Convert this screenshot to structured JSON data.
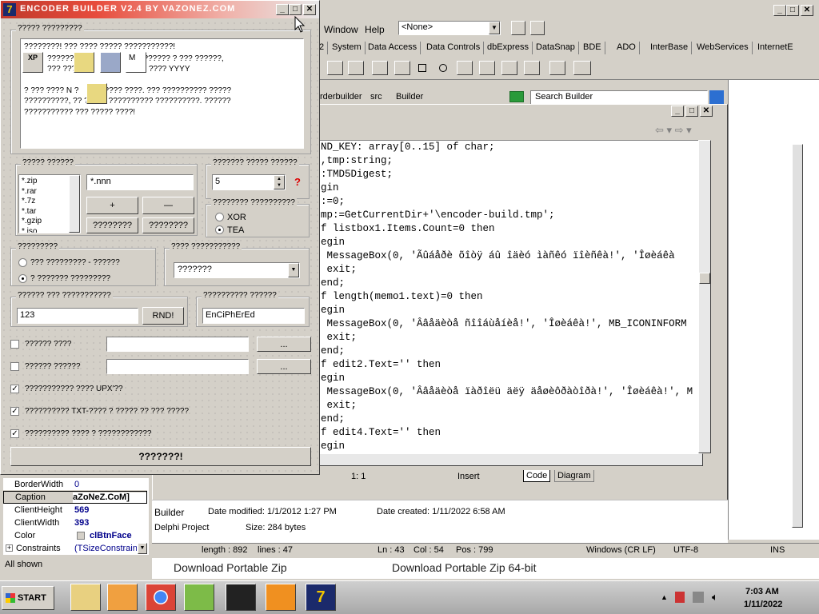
{
  "ide": {
    "menu": [
      "Window",
      "Help"
    ],
    "config_select": "<None>",
    "palette_tabs": [
      "2",
      "System",
      "Data Access",
      "Data Controls",
      "dbExpress",
      "DataSnap",
      "BDE",
      "ADO",
      "InterBase",
      "WebServices",
      "InternetE"
    ],
    "breadcrumb": [
      "rderbuilder",
      "src",
      "Builder"
    ],
    "search_placeholder": "Search Builder"
  },
  "editor": {
    "code_lines": [
      {
        "t": "ND_KEY: array[0..15] of char;"
      },
      {
        "t": ",tmp:string;"
      },
      {
        "t": ":TMD5Digest;"
      },
      {
        "t": "gin"
      },
      {
        "t": ":=0;"
      },
      {
        "t": "mp:=GetCurrentDir+'\\encoder-build.tmp';"
      },
      {
        "t": "f listbox1.Items.Count=0 then"
      },
      {
        "t": "egin"
      },
      {
        "t": " MessageBox(0, 'Ãûáåðè õîòÿ áû îäèó ìàñêó ïîèñêà!', 'Îøèáêà"
      },
      {
        "t": " exit;"
      },
      {
        "t": "end;"
      },
      {
        "t": "f length(memo1.text)=0 then"
      },
      {
        "t": "egin"
      },
      {
        "t": " MessageBox(0, 'Ââåäèòå ñîîáùåíèå!', 'Îøèáêà!', MB_ICONINFORM"
      },
      {
        "t": " exit;"
      },
      {
        "t": "end;"
      },
      {
        "t": "f edit2.Text='' then"
      },
      {
        "t": "egin"
      },
      {
        "t": " MessageBox(0, 'Ââåäèòå ïàðîëü äëÿ äåøèôðàòîðà!', 'Îøèáêà!', M"
      },
      {
        "t": " exit;"
      },
      {
        "t": "end;"
      },
      {
        "t": "f edit4.Text='' then"
      },
      {
        "t": "egin"
      }
    ],
    "position": "1:   1",
    "mode": "Insert",
    "tabs": [
      "Code",
      "Diagram"
    ]
  },
  "object_inspector": {
    "rows": [
      {
        "name": "BorderWidth",
        "value": "0"
      },
      {
        "name": "Caption",
        "value": "aZoNeZ.CoM]"
      },
      {
        "name": "ClientHeight",
        "value": "569"
      },
      {
        "name": "ClientWidth",
        "value": "393"
      },
      {
        "name": "Color",
        "value": "clBtnFace"
      },
      {
        "name": "Constraints",
        "value": "(TSizeConstrain"
      }
    ],
    "footer": "All shown"
  },
  "file_info": {
    "name": "Builder",
    "type": "Delphi Project",
    "modified": "Date modified:  1/1/2012 1:27 PM",
    "created": "Date created:  1/11/2022 6:58 AM",
    "size": "Size:  284 bytes"
  },
  "status_bar": {
    "length": "length : 892",
    "lines": "lines : 47",
    "ln": "Ln : 43",
    "col": "Col : 54",
    "pos": "Pos : 799",
    "eol": "Windows (CR LF)",
    "enc": "UTF-8",
    "ins": "INS"
  },
  "downloads": [
    "Download Portable Zip",
    "Download Portable Zip 64-bit"
  ],
  "builder": {
    "title": "ENCODER BUILDER V2.4 BY VAZONEZ.COM",
    "group_info": "????? ?????????",
    "info_line1": "????????! ??? ???? ????? ???????????!",
    "info_line2a": "???????",
    "info_line2b": "??????? ? ??? ??????,",
    "info_line3a": "??? ???",
    "info_line3b": "???? YYYY",
    "info_line4a": "? ??? ???? N ?",
    "info_line4b": "????? ????. ??? ?????????? ?????",
    "info_line5": "??????????, ?? ????? ?????????? ??????????. ??????",
    "info_line6": "??????????? ??? ????? ????!",
    "icon_xp": "XP",
    "icon_m": "M",
    "group_masks": "????? ??????",
    "masks": [
      "*.zip",
      "*.rar",
      "*.7z",
      "*.tar",
      "*.gzip",
      "*.iso"
    ],
    "mask_input": "*.nnn",
    "add_label": "+",
    "remove_label": "—",
    "mask_btn1": "????????",
    "mask_btn2": "????????",
    "group_count": "??????? ????? ??????",
    "count_value": "5",
    "help_mark": "?",
    "group_algo": "???????? ??????????",
    "algo_xor": "XOR",
    "algo_tea": "TEA",
    "group_mode": "?????????",
    "mode1": "??? ????????? - ??????",
    "mode2": "? ??????? ?????????",
    "group_select": "???? ???????????",
    "select_value": "???????",
    "group_key": "?????? ??? ???????????",
    "key_value": "123",
    "rnd_label": "RND!",
    "group_marker": "?????????? ??????",
    "marker_value": "EnCiPhErEd",
    "opt1": "?????? ????",
    "opt2": "?????? ??????",
    "browse_label": "...",
    "check1": "??????????? ???? UPX'??",
    "check2": "?????????? TXT-???? ? ????? ?? ??? ?????",
    "check3": "?????????? ???? ? ????????????",
    "build_label": "???????!"
  },
  "taskbar": {
    "start": "START",
    "time": "7:03 AM",
    "date": "1/11/2022"
  }
}
